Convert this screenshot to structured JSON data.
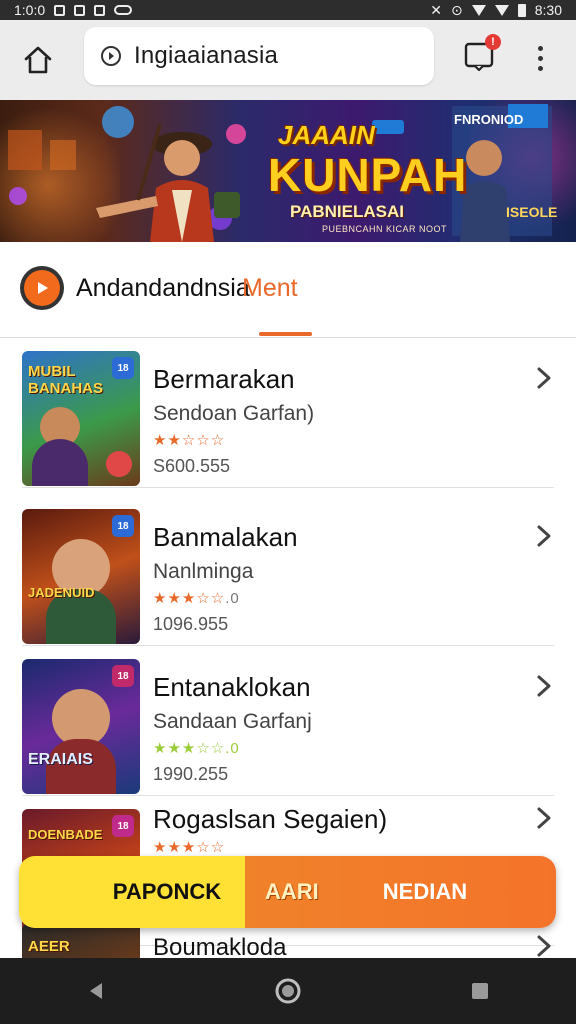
{
  "status_bar": {
    "time_left": "1:0:0",
    "time_right": "8:30"
  },
  "browser": {
    "url": "Ingiaaianasia",
    "tab_badge": "!"
  },
  "banner": {
    "line1": "JAAAIN",
    "line2": "KUNPAH",
    "line3": "PABNIELASAI",
    "line4": "PUEBNCAHN KICAR NOOT",
    "tag": "FNRONIOD",
    "corner": "ISEOLE"
  },
  "tabs": {
    "app_name": "Andandandnsia",
    "active_tab": "Ment"
  },
  "games": [
    {
      "name": "Bermarakan",
      "subtitle": "Sendoan Garfan)",
      "stars": "★★☆☆☆",
      "rating_text": "",
      "price": "S600.555",
      "thumb_label": "MUBIL BANAHAS",
      "star_color": "#e8692a"
    },
    {
      "name": "Banmalakan",
      "subtitle": "Nanlminga",
      "stars": "★★★☆☆",
      "rating_text": ".0",
      "price": "1096.955",
      "thumb_label": "JADENUID",
      "star_color": "#e8692a"
    },
    {
      "name": "Entanaklokan",
      "subtitle": "Sandaan Garfanj",
      "stars": "★★★☆☆",
      "rating_text": ".0",
      "price": "1990.255",
      "thumb_label": "ERAIAIS",
      "star_color": "#9ccc3a"
    },
    {
      "name": "Rogaslsan Segaien)",
      "subtitle": "",
      "stars": "★★★☆☆",
      "rating_text": "",
      "price": "",
      "thumb_label": "DOENBADE",
      "star_color": "#e8692a"
    },
    {
      "name": "Boumakloda",
      "subtitle": "",
      "stars": "",
      "rating_text": "",
      "price": "",
      "thumb_label": "AEER",
      "star_color": "#e8692a"
    }
  ],
  "actions": {
    "left": "PAPONCK",
    "middle": "AARI",
    "right": "NEDIAN"
  },
  "colors": {
    "accent": "#e8692a",
    "action_yellow": "#ffe034",
    "action_orange": "#f4732a"
  }
}
